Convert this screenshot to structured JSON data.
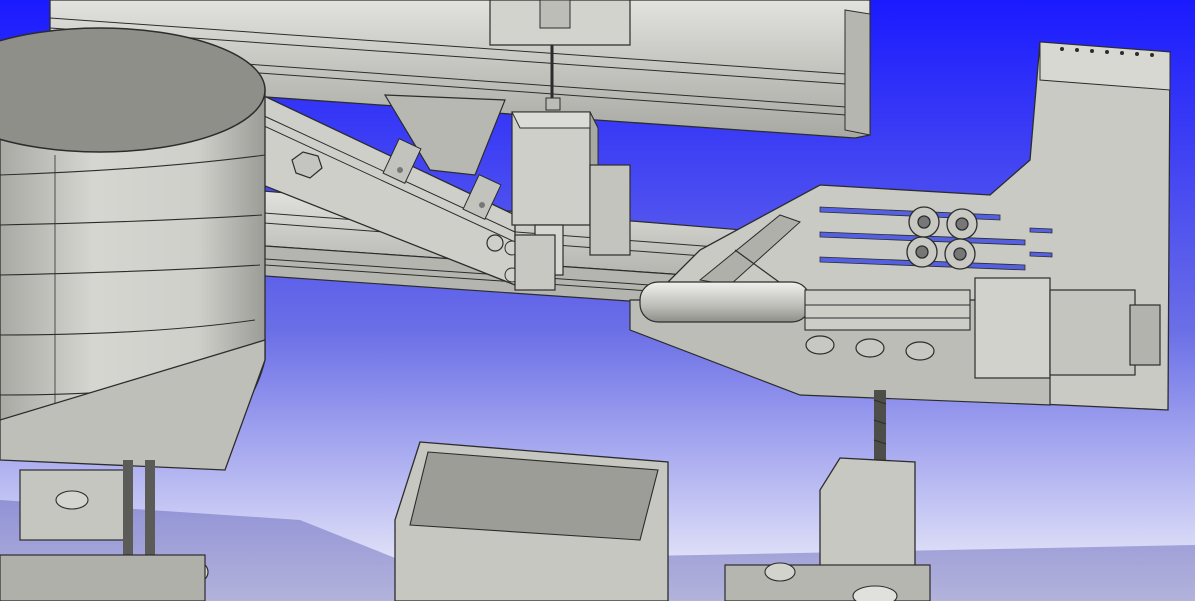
{
  "viewport": {
    "background_top": "#1a1aff",
    "background_mid": "#6b6fe6",
    "background_bottom": "#f4f4fb",
    "part_color": "#c9c9c4",
    "part_light": "#e3e3df",
    "part_dark": "#9d9d98",
    "edge_color": "#2c2c2c"
  },
  "parts": [
    {
      "name": "upper-aluminum-rail"
    },
    {
      "name": "diagonal-support-arm"
    },
    {
      "name": "lower-aluminum-rail"
    },
    {
      "name": "cylindrical-tank"
    },
    {
      "name": "tank-base-plate"
    },
    {
      "name": "stepper-motor-vertical"
    },
    {
      "name": "side-mounting-plate"
    },
    {
      "name": "syringe-pump-assembly"
    },
    {
      "name": "stepper-motor-horizontal"
    },
    {
      "name": "lead-screw-vertical"
    },
    {
      "name": "lift-carriage-block"
    },
    {
      "name": "open-container-tray"
    },
    {
      "name": "left-lead-screws"
    }
  ]
}
